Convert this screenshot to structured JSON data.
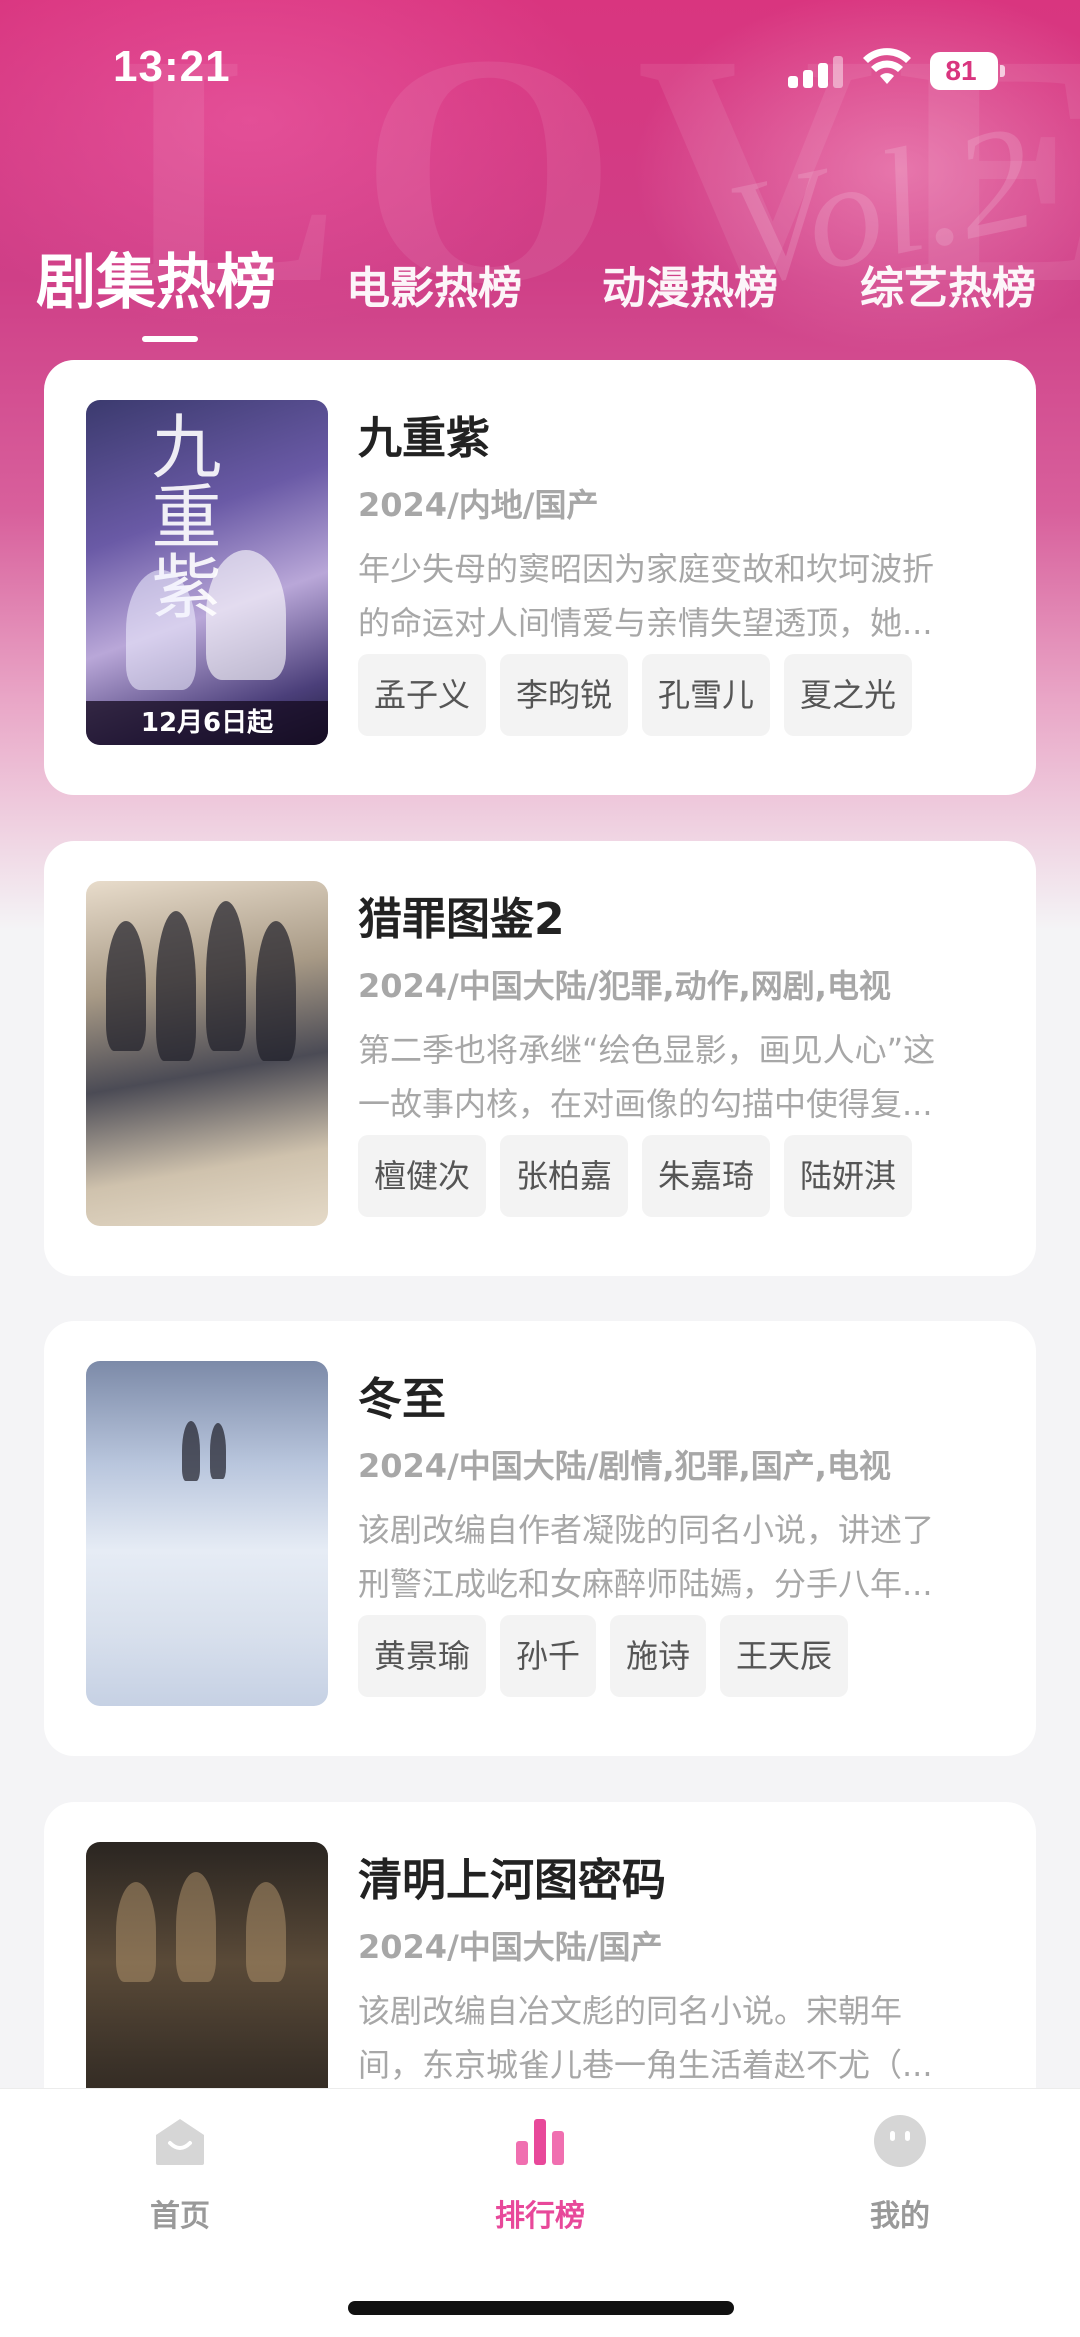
{
  "status_bar": {
    "time": "13:21",
    "battery": "81"
  },
  "tabs": [
    {
      "label": "剧集热榜",
      "active": true
    },
    {
      "label": "电影热榜",
      "active": false
    },
    {
      "label": "动漫热榜",
      "active": false
    },
    {
      "label": "综艺热榜",
      "active": false
    }
  ],
  "items": [
    {
      "title": "九重紫",
      "meta": "2024/内地/国产",
      "desc_line1": "年少失母的窦昭因为家庭变故和坎坷波折",
      "desc_line2": "的命运对人间情爱与亲情失望透顶，她...",
      "tags": [
        "孟子义",
        "李昀锐",
        "孔雪儿",
        "夏之光"
      ],
      "poster_art": "九重紫",
      "poster_badge": "12月6日起"
    },
    {
      "title": "猎罪图鉴2",
      "meta": "2024/中国大陆/犯罪,动作,网剧,电视",
      "desc_line1": "第二季也将承继“绘色显影，画见人心”这",
      "desc_line2": "一故事内核，在对画像的勾描中使得复...",
      "tags": [
        "檀健次",
        "张柏嘉",
        "朱嘉琦",
        "陆妍淇"
      ]
    },
    {
      "title": "冬至",
      "meta": "2024/中国大陆/剧情,犯罪,国产,电视",
      "desc_line1": "该剧改编自作者凝陇的同名小说，讲述了",
      "desc_line2": "刑警江成屹和女麻醉师陆嫣，分手八年...",
      "tags": [
        "黄景瑜",
        "孙千",
        "施诗",
        "王天辰"
      ]
    },
    {
      "title": "清明上河图密码",
      "meta": "2024/中国大陆/国产",
      "desc_line1": "该剧改编自冶文彪的同名小说。宋朝年",
      "desc_line2": "间，东京城雀儿巷一角生活着赵不尤（...",
      "tags": []
    }
  ],
  "bottom_nav": [
    {
      "label": "首页",
      "icon": "home-icon",
      "active": false
    },
    {
      "label": "排行榜",
      "icon": "chart-bar-icon",
      "active": true
    },
    {
      "label": "我的",
      "icon": "smiley-icon",
      "active": false
    }
  ],
  "colors": {
    "accent": "#e8489a",
    "header": "#d9357f"
  }
}
